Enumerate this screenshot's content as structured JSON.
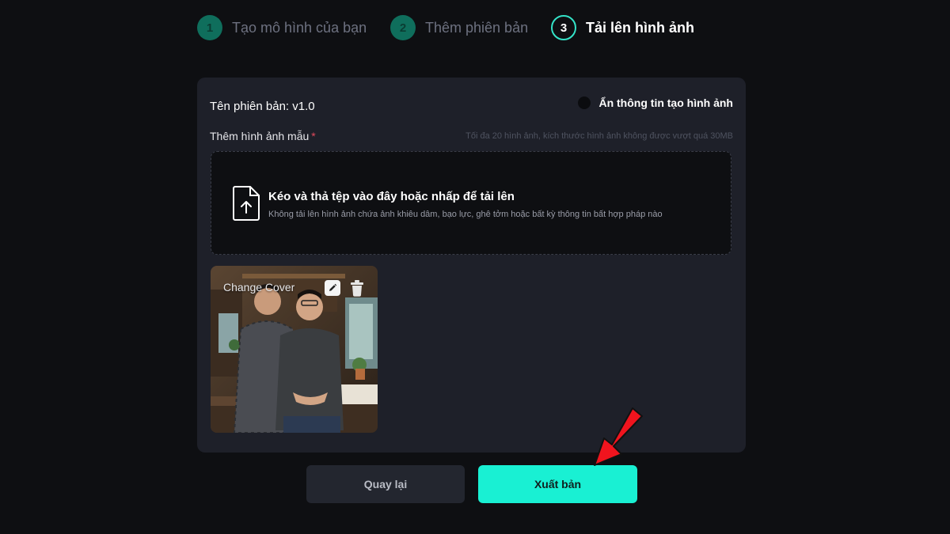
{
  "stepper": {
    "steps": [
      {
        "number": "1",
        "label": "Tạo mô hình của bạn"
      },
      {
        "number": "2",
        "label": "Thêm phiên bản"
      },
      {
        "number": "3",
        "label": "Tải lên hình ảnh"
      }
    ],
    "active_step": 3
  },
  "form": {
    "version_name": "Tên phiên bản: v1.0",
    "hide_info_label": "Ẩn thông tin tạo hình ảnh",
    "sample_images_label": "Thêm hình ảnh mẫu",
    "required_mark": "*",
    "limit_hint": "Tối đa 20 hình ảnh, kích thước hình ảnh không được vượt quá 30MB"
  },
  "dropzone": {
    "icon": "file-upload-icon",
    "title": "Kéo và thả tệp vào đây hoặc nhấp để tải lên",
    "note": "Không tải lên hình ảnh chứa ảnh khiêu dâm, bạo lực, ghê tởm hoặc bất kỳ thông tin bất hợp pháp nào"
  },
  "thumbnail": {
    "change_cover_label": "Change Cover",
    "edit_icon": "pencil-icon",
    "delete_icon": "trash-icon"
  },
  "actions": {
    "back_label": "Quay lại",
    "publish_label": "Xuất bản"
  },
  "colors": {
    "accent": "#19f0d3",
    "step_done": "#0f6e5c",
    "annotation_arrow": "#f0141e",
    "card_bg": "#1e2029",
    "page_bg": "#0e0f12"
  }
}
